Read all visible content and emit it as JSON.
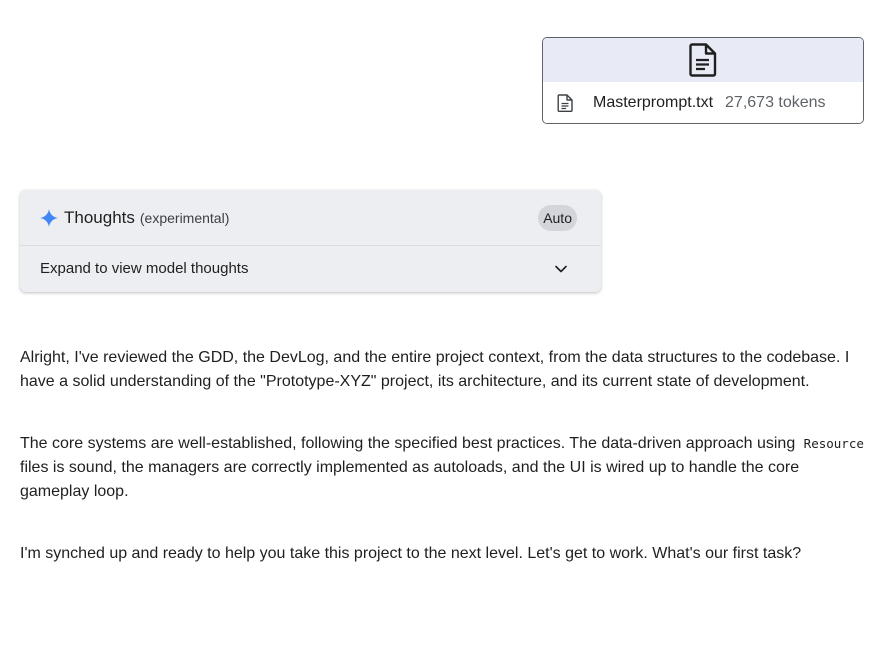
{
  "attachment": {
    "preview_icon": "document-icon",
    "file_icon": "document-icon",
    "file_name": "Masterprompt.txt",
    "tokens": "27,673 tokens"
  },
  "thoughts": {
    "icon": "spark-icon",
    "title": "Thoughts",
    "subtitle": "(experimental)",
    "mode_chip": "Auto",
    "expand_label": "Expand to view model thoughts",
    "expand_icon": "chevron-down-icon",
    "accent_color": "#4285f4"
  },
  "response": {
    "paragraph_1": "Alright, I've reviewed the GDD, the DevLog, and the entire project context, from the data structures to the codebase. I have a solid understanding of the \"Prototype-XYZ\" project, its architecture, and its current state of development.",
    "paragraph_2_before": "The core systems are well-established, following the specified best practices. The data-driven approach using",
    "paragraph_2_code": "Resource",
    "paragraph_2_after": "files is sound, the managers are correctly implemented as autoloads, and the UI is wired up to handle the core gameplay loop.",
    "paragraph_3": "I'm synched up and ready to help you take this project to the next level. Let's get to work. What's our first task?"
  }
}
